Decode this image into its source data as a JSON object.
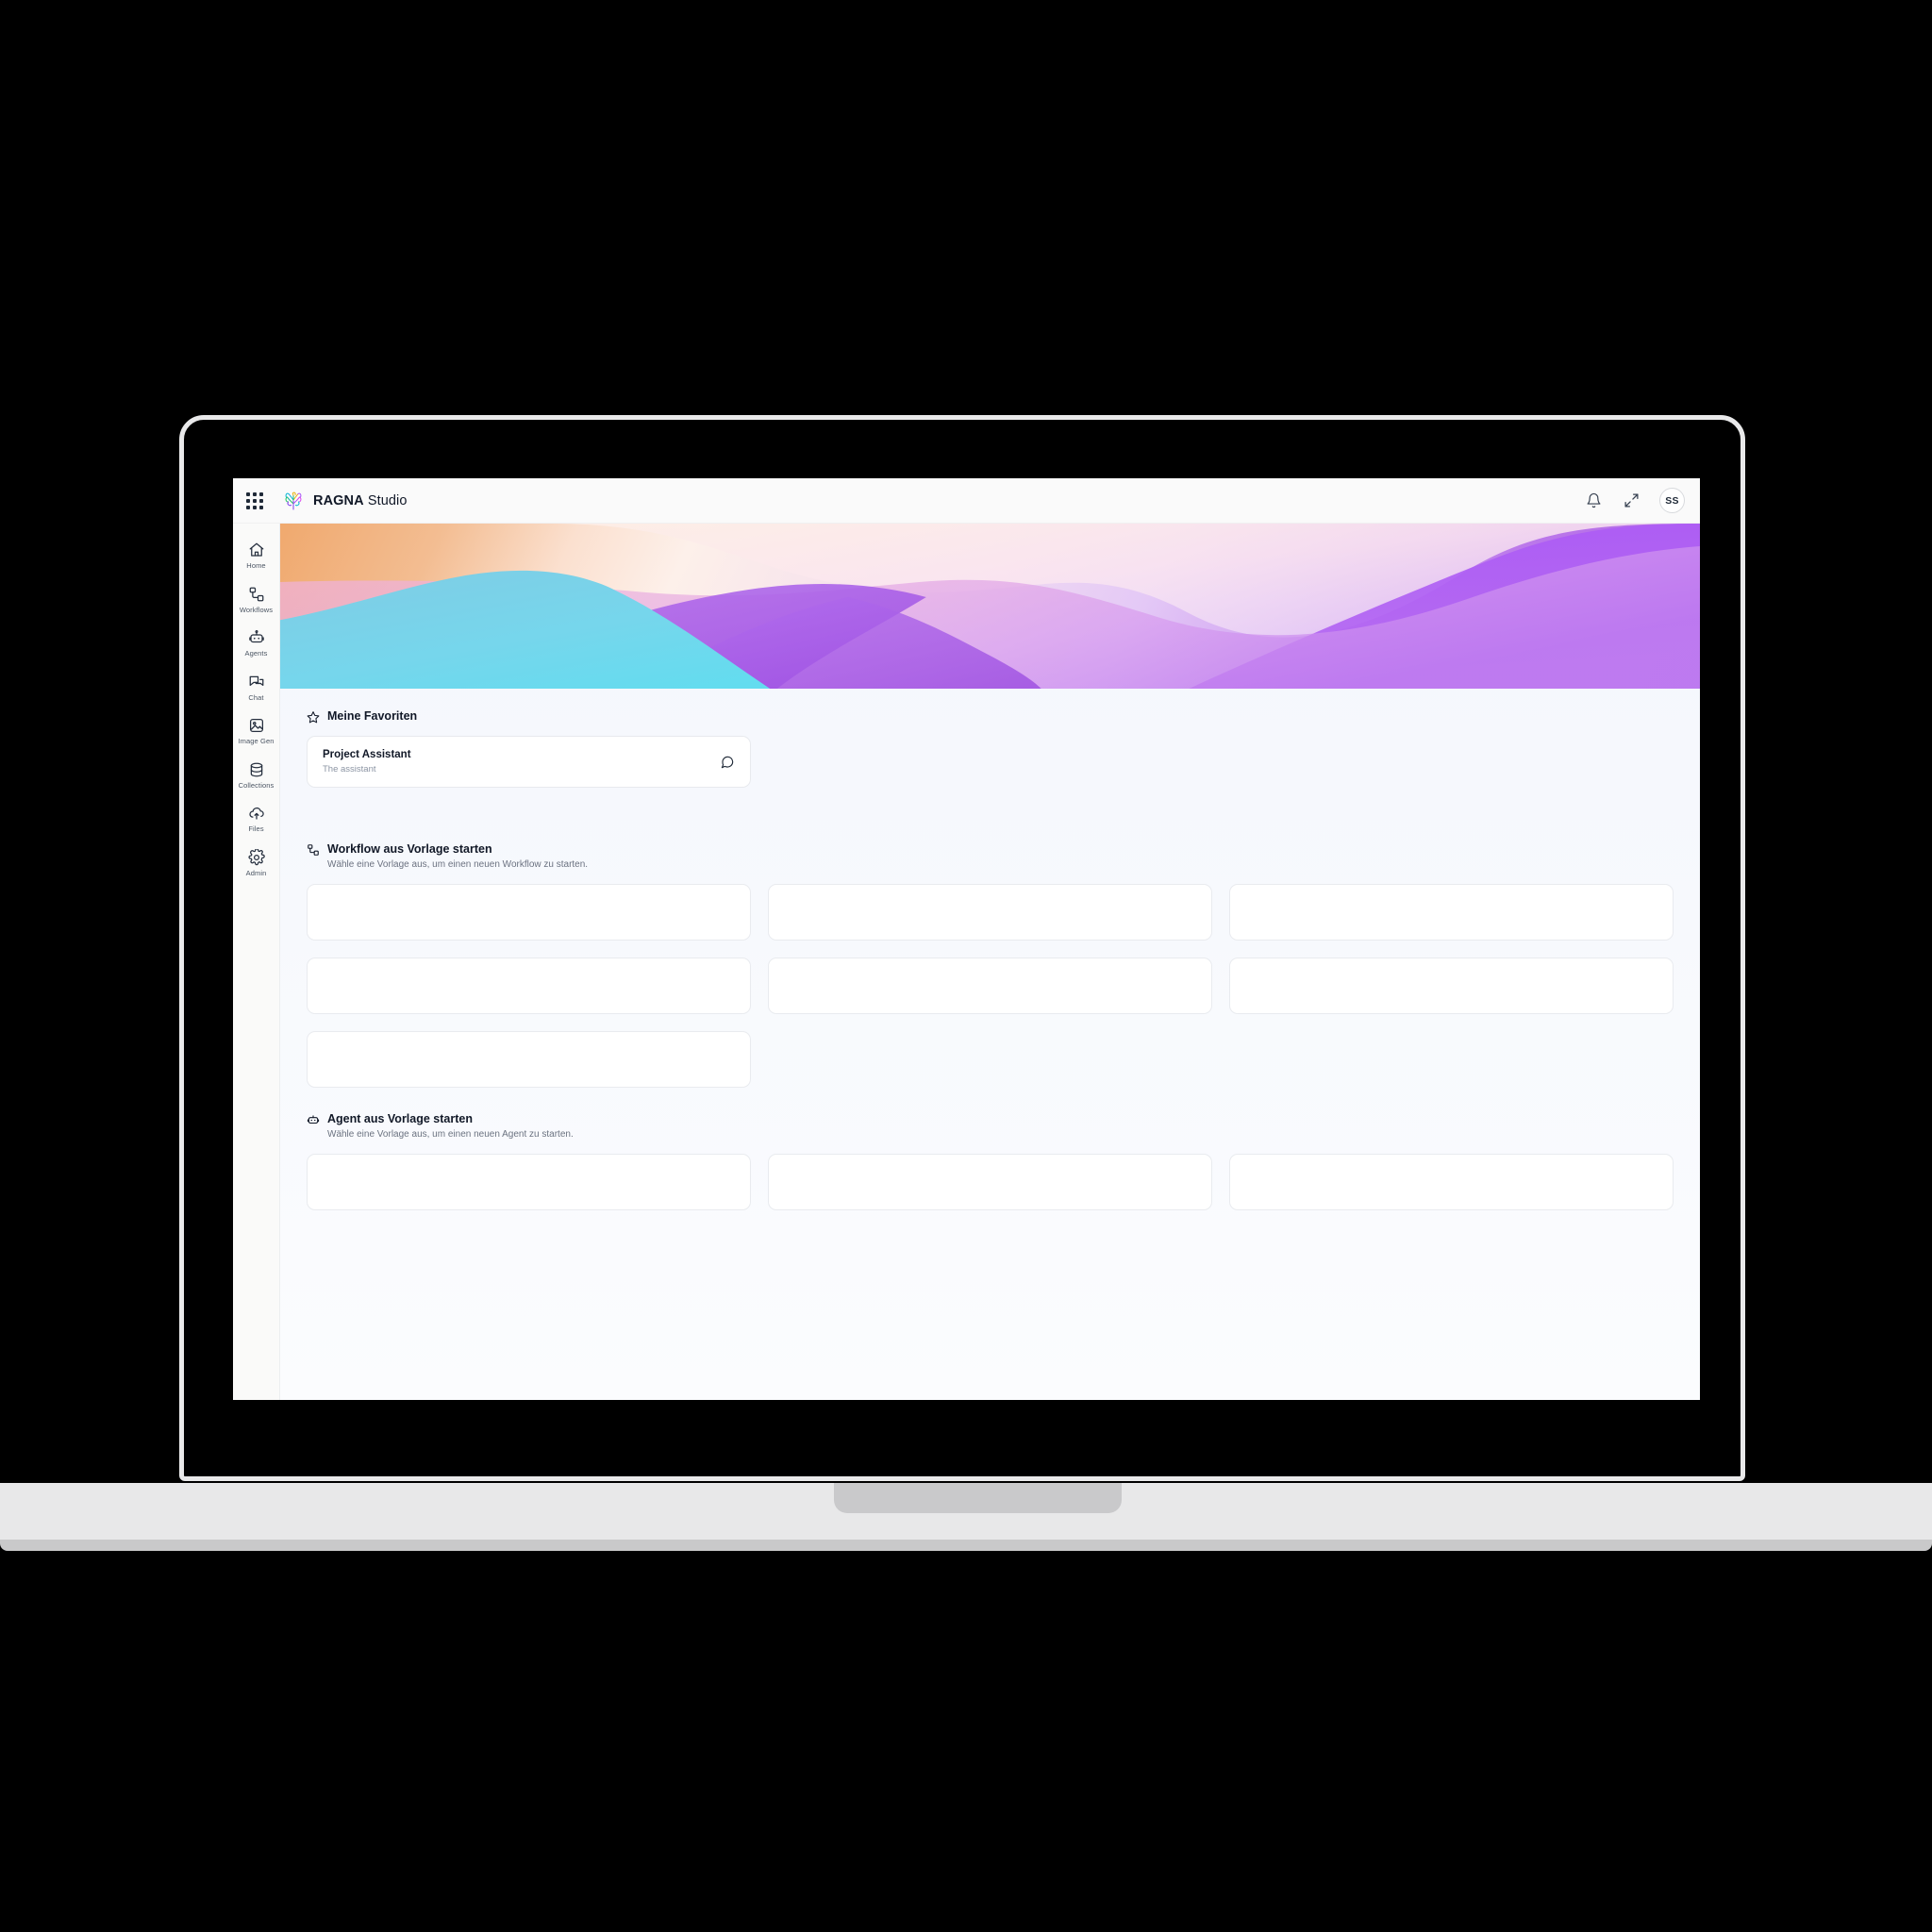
{
  "app": {
    "brand_bold": "RAGNA",
    "brand_light": "Studio",
    "logo_icon": "brain-tree-logo",
    "apps_grid_icon": "apps-grid-icon"
  },
  "topbar": {
    "notifications_icon": "bell-icon",
    "fullscreen_icon": "fullscreen-expand-icon",
    "avatar_initials": "SS"
  },
  "sidebar": {
    "items": [
      {
        "label": "Home",
        "icon": "home-icon"
      },
      {
        "label": "Workflows",
        "icon": "workflow-nodes-icon"
      },
      {
        "label": "Agents",
        "icon": "robot-icon"
      },
      {
        "label": "Chat",
        "icon": "chat-bubbles-icon"
      },
      {
        "label": "Image Gen",
        "icon": "image-icon"
      },
      {
        "label": "Collections",
        "icon": "database-icon"
      },
      {
        "label": "Files",
        "icon": "cloud-upload-icon"
      },
      {
        "label": "Admin",
        "icon": "gear-icon"
      }
    ]
  },
  "hero": {
    "alt": "abstract gradient waves banner",
    "colors": {
      "orange": "#f0a96e",
      "peach": "#fbe0cf",
      "cream": "#fdf0ea",
      "pink": "#f2c8e0",
      "lilac": "#d9a8f0",
      "purple": "#ad60e4",
      "violet": "#a855f7",
      "cyan": "#67d3ea",
      "blue": "#6ec4e0"
    }
  },
  "favorites": {
    "icon": "star-icon",
    "title": "Meine Favoriten",
    "cards": [
      {
        "name": "Project Assistant",
        "description": "The assistant",
        "action_icon": "chat-bubble-icon"
      }
    ]
  },
  "workflow_templates": {
    "icon": "workflow-nodes-icon",
    "title": "Workflow aus Vorlage starten",
    "subtitle": "Wähle eine Vorlage aus, um einen neuen Workflow zu starten.",
    "placeholder_count": 7
  },
  "agent_templates": {
    "icon": "robot-icon",
    "title": "Agent aus Vorlage starten",
    "subtitle": "Wähle eine Vorlage aus, um einen neuen Agent zu starten.",
    "placeholder_count": 3
  },
  "theme": {
    "page_bg": "#f4f7fd",
    "sidebar_bg": "#fafaf9",
    "topbar_bg": "#fafafa",
    "card_bg": "#ffffff",
    "card_border": "#e8eaee",
    "text_primary": "#111827",
    "text_muted": "#6b7280"
  }
}
